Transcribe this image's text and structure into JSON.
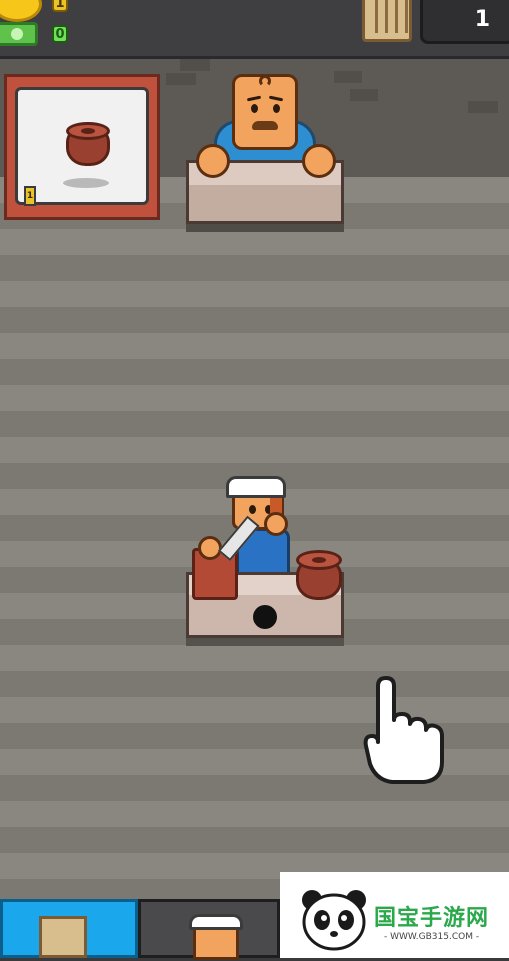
{
  "hud": {
    "coin_count": "1",
    "cash_count": "0",
    "level": "1"
  },
  "order": {
    "item_icon": "clay-pot-icon",
    "count": "1"
  },
  "customer": {
    "name": "customer"
  },
  "worker": {
    "name": "potter-worker"
  },
  "tutorial": {
    "pointer_icon": "tap-hand-icon"
  },
  "bottom_tabs": [
    {
      "icon": "planks-icon",
      "active": true
    },
    {
      "icon": "worker-icon",
      "active": false
    }
  ],
  "watermark": {
    "title": "国宝手游网",
    "url": "- WWW.GB315.COM -"
  },
  "colors": {
    "tab_active": "#1aa7ec",
    "coin": "#f6c61a",
    "cash": "#5fc24b",
    "clay": "#9a4030"
  }
}
